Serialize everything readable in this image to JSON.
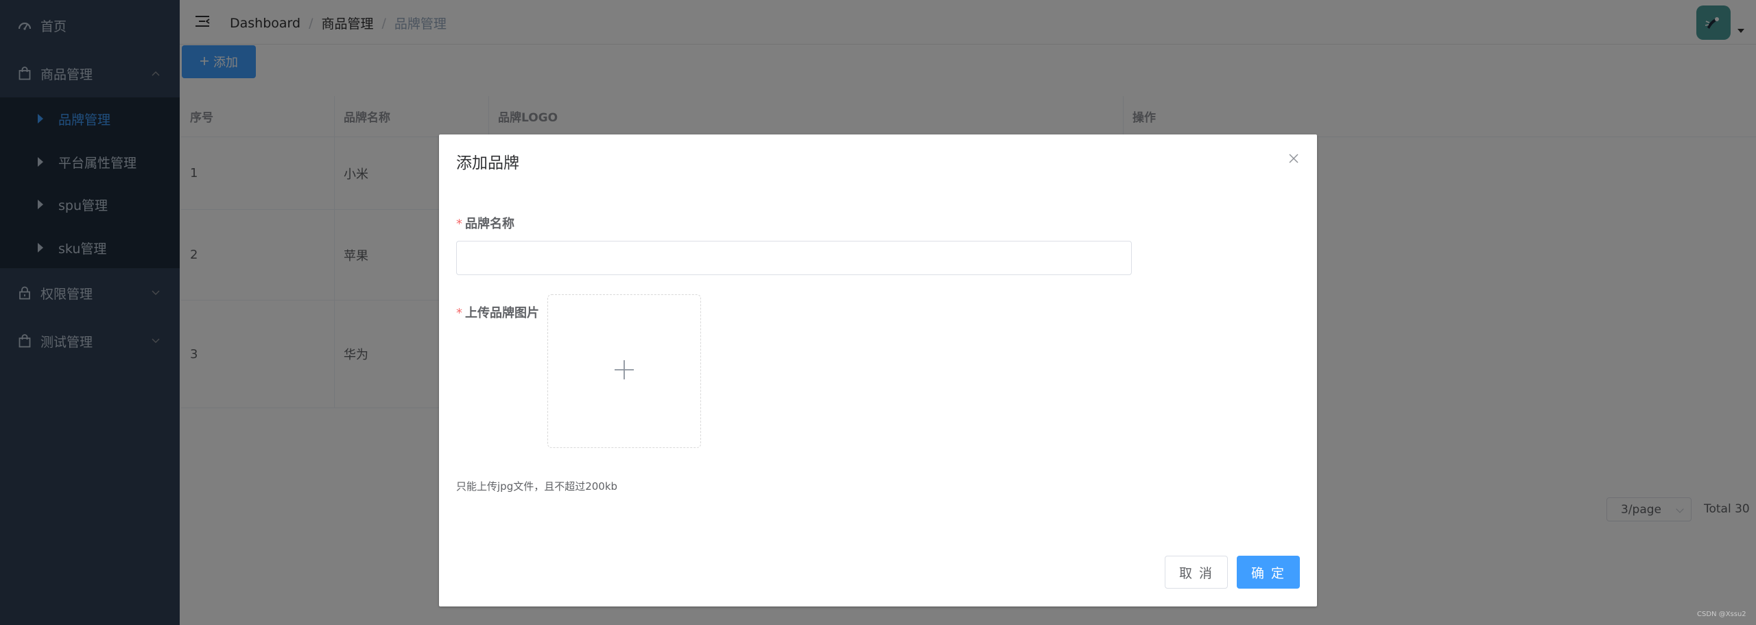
{
  "sidebar": {
    "home": "首页",
    "product_mgmt": "商品管理",
    "sub_items": [
      "品牌管理",
      "平台属性管理",
      "spu管理",
      "sku管理"
    ],
    "permission_mgmt": "权限管理",
    "test_mgmt": "测试管理"
  },
  "header": {
    "breadcrumb": [
      "Dashboard",
      "商品管理",
      "品牌管理"
    ],
    "separator": "/"
  },
  "main": {
    "add_button": "添加",
    "table": {
      "headers": [
        "序号",
        "品牌名称",
        "品牌LOGO",
        "操作"
      ],
      "rows": [
        {
          "index": "1",
          "name": "小米"
        },
        {
          "index": "2",
          "name": "苹果"
        },
        {
          "index": "3",
          "name": "华为"
        }
      ]
    },
    "pagination": {
      "page_size": "3/page",
      "total": "Total 30"
    }
  },
  "dialog": {
    "title": "添加品牌",
    "required_mark": "*",
    "name_label": "品牌名称",
    "name_value": "",
    "upload_label": "上传品牌图片",
    "tip": "只能上传jpg文件，且不超过200kb",
    "cancel": "取 消",
    "confirm": "确 定"
  },
  "watermark": "CSDN @Xssu2",
  "colors": {
    "sidebar_bg": "#304156",
    "primary": "#409eff",
    "required": "#f56c6c"
  }
}
